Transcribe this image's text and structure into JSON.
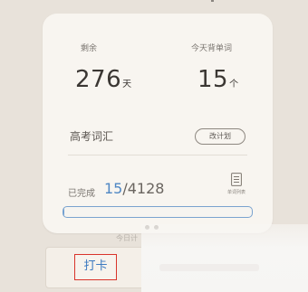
{
  "stats": {
    "remaining": {
      "label": "剩余",
      "value": "276",
      "unit": "天"
    },
    "today": {
      "label": "今天背单词",
      "value": "15",
      "unit": "个"
    }
  },
  "wordbook": {
    "name": "高考词汇",
    "change_plan_label": "改计划"
  },
  "progress": {
    "label": "已完成",
    "done": "15",
    "total": "/4128",
    "fraction": 0.0036,
    "word_list_label": "单词列表"
  },
  "pager": {
    "count": 2,
    "active_index": 0
  },
  "footer": {
    "today_hint": "今日计",
    "checkin_label": "打卡"
  },
  "colors": {
    "accent_blue": "#4f87c4",
    "highlight_red": "#d9342b",
    "card_bg": "#f8f5f0",
    "screen_bg": "#e8e2da"
  },
  "icons": {
    "word_list": "list-document-icon"
  }
}
